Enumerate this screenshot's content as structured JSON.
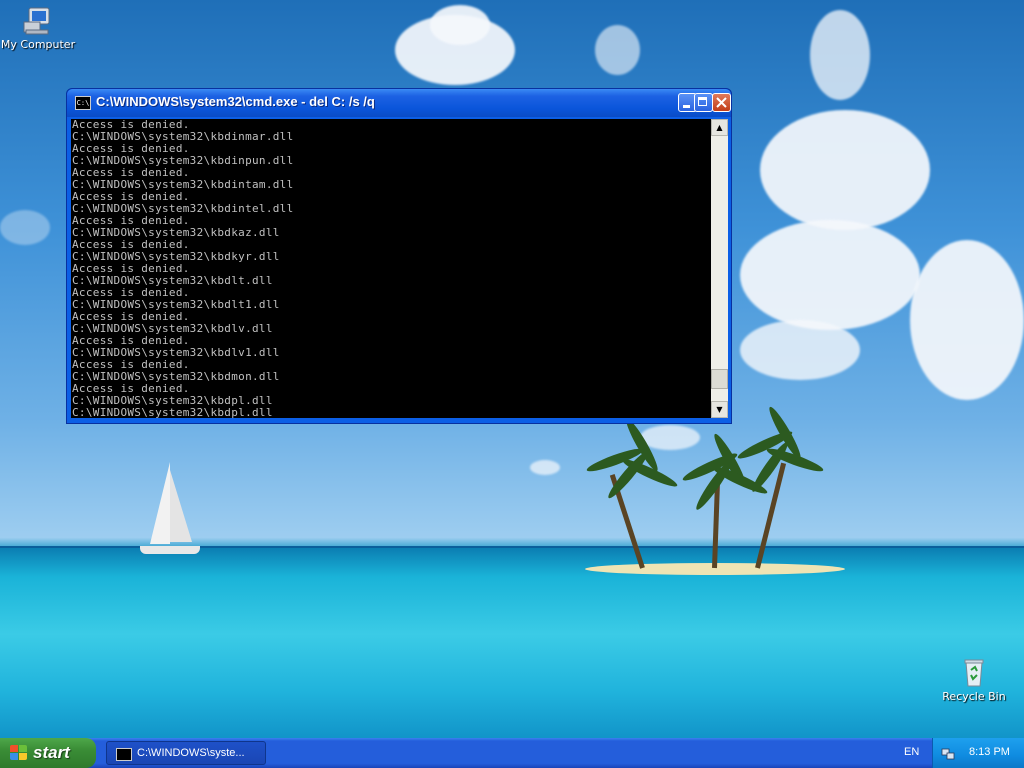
{
  "desktop": {
    "icons": [
      {
        "label": "My Computer"
      },
      {
        "label": "Recycle Bin"
      }
    ]
  },
  "window": {
    "title": "C:\\WINDOWS\\system32\\cmd.exe - del C: /s /q",
    "title_icon": "C:\\",
    "console_lines": [
      "Access is denied.",
      "C:\\WINDOWS\\system32\\kbdinmar.dll",
      "Access is denied.",
      "C:\\WINDOWS\\system32\\kbdinpun.dll",
      "Access is denied.",
      "C:\\WINDOWS\\system32\\kbdintam.dll",
      "Access is denied.",
      "C:\\WINDOWS\\system32\\kbdintel.dll",
      "Access is denied.",
      "C:\\WINDOWS\\system32\\kbdkaz.dll",
      "Access is denied.",
      "C:\\WINDOWS\\system32\\kbdkyr.dll",
      "Access is denied.",
      "C:\\WINDOWS\\system32\\kbdlt.dll",
      "Access is denied.",
      "C:\\WINDOWS\\system32\\kbdlt1.dll",
      "Access is denied.",
      "C:\\WINDOWS\\system32\\kbdlv.dll",
      "Access is denied.",
      "C:\\WINDOWS\\system32\\kbdlv1.dll",
      "Access is denied.",
      "C:\\WINDOWS\\system32\\kbdmon.dll",
      "Access is denied.",
      "C:\\WINDOWS\\system32\\kbdpl.dll",
      "C:\\WINDOWS\\system32\\kbdpl.dll"
    ],
    "scroll_position": 0.95
  },
  "taskbar": {
    "start_label": "start",
    "task_label": "C:\\WINDOWS\\syste...",
    "language": "EN",
    "clock": "8:13 PM"
  },
  "colors": {
    "xp_blue": "#245edb",
    "start_green": "#3a8d36",
    "console_text": "#c0c0c0",
    "console_bg": "#000000"
  }
}
